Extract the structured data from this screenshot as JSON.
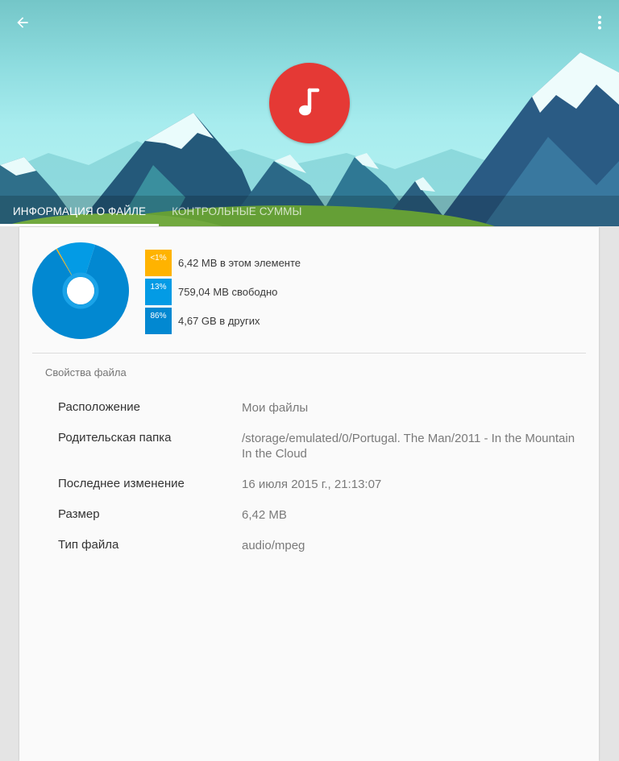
{
  "header": {
    "back_icon": "arrow-back-icon",
    "menu_icon": "more-vert-icon",
    "file_type_icon": "music-note-icon",
    "avatar_color": "#e53935",
    "tabs": [
      {
        "label": "ИНФОРМАЦИЯ О ФАЙЛЕ",
        "active": true
      },
      {
        "label": "КОНТРОЛЬНЫЕ СУММЫ",
        "active": false
      }
    ]
  },
  "storage": {
    "segments": [
      {
        "percent_label": "<1%",
        "text": "6,42 MB в этом элементе",
        "color": "#ffb300",
        "fraction": 0.004
      },
      {
        "percent_label": "13%",
        "text": "759,04 MB свободно",
        "color": "#039be5",
        "fraction": 0.13
      },
      {
        "percent_label": "86%",
        "text": "4,67 GB в других",
        "color": "#0288d1",
        "fraction": 0.866
      }
    ]
  },
  "properties": {
    "title": "Свойства файла",
    "rows": [
      {
        "label": "Расположение",
        "value": "Мои файлы"
      },
      {
        "label": "Родительская папка",
        "value": "/storage/emulated/0/Portugal. The Man/2011 - In the Mountain In the Cloud"
      },
      {
        "label": "Последнее изменение",
        "value": "16 июля 2015 г., 21:13:07"
      },
      {
        "label": "Размер",
        "value": "6,42 MB"
      },
      {
        "label": "Тип файла",
        "value": "audio/mpeg"
      }
    ]
  }
}
